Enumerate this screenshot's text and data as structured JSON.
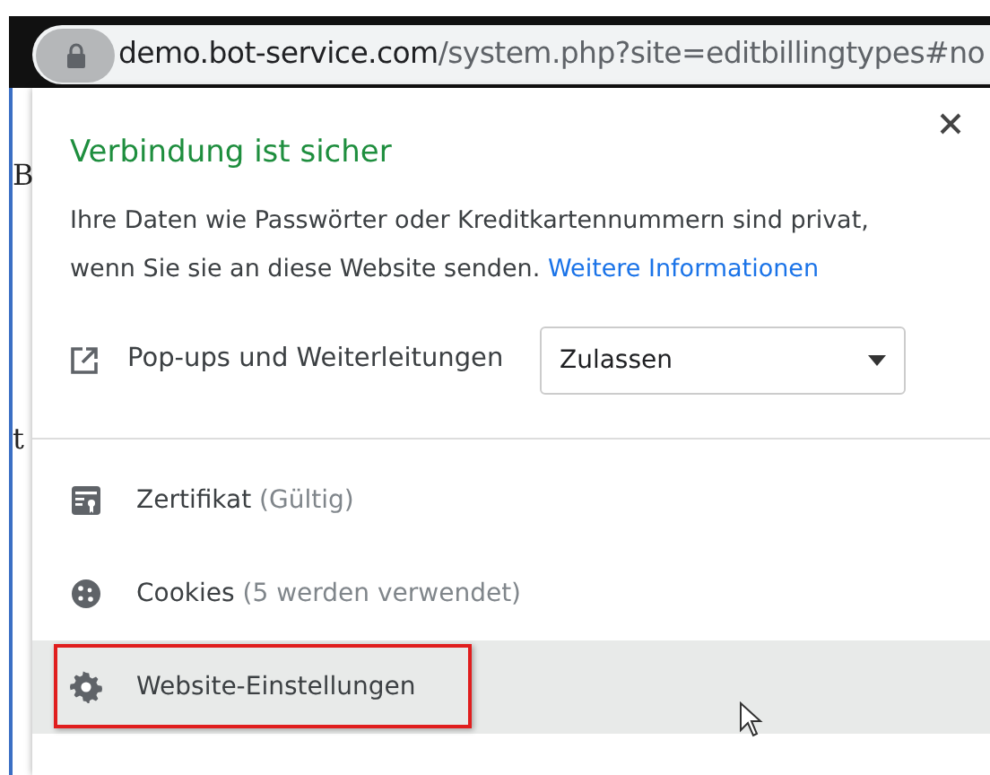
{
  "address_bar": {
    "host": "demo.bot-service.com",
    "path": "/system.php?site=editbillingtypes#no"
  },
  "background_text": [
    "B",
    "t"
  ],
  "popup": {
    "title": "Verbindung ist sicher",
    "message": "Ihre Daten wie Passwörter oder Kreditkartennummern sind privat, wenn Sie sie an diese Website senden.",
    "link": "Weitere Informationen",
    "permission": {
      "label": "Pop-ups und Weiterleitungen",
      "value": "Zulassen"
    },
    "items": [
      {
        "kind": "certificate",
        "label": "Zertifikat",
        "detail": "(Gültig)",
        "hovered": false,
        "highlighted": false
      },
      {
        "kind": "cookies",
        "label": "Cookies",
        "detail": "(5 werden verwendet)",
        "hovered": false,
        "highlighted": false
      },
      {
        "kind": "settings",
        "label": "Website-Einstellungen",
        "hovered": true,
        "highlighted": true
      }
    ]
  }
}
